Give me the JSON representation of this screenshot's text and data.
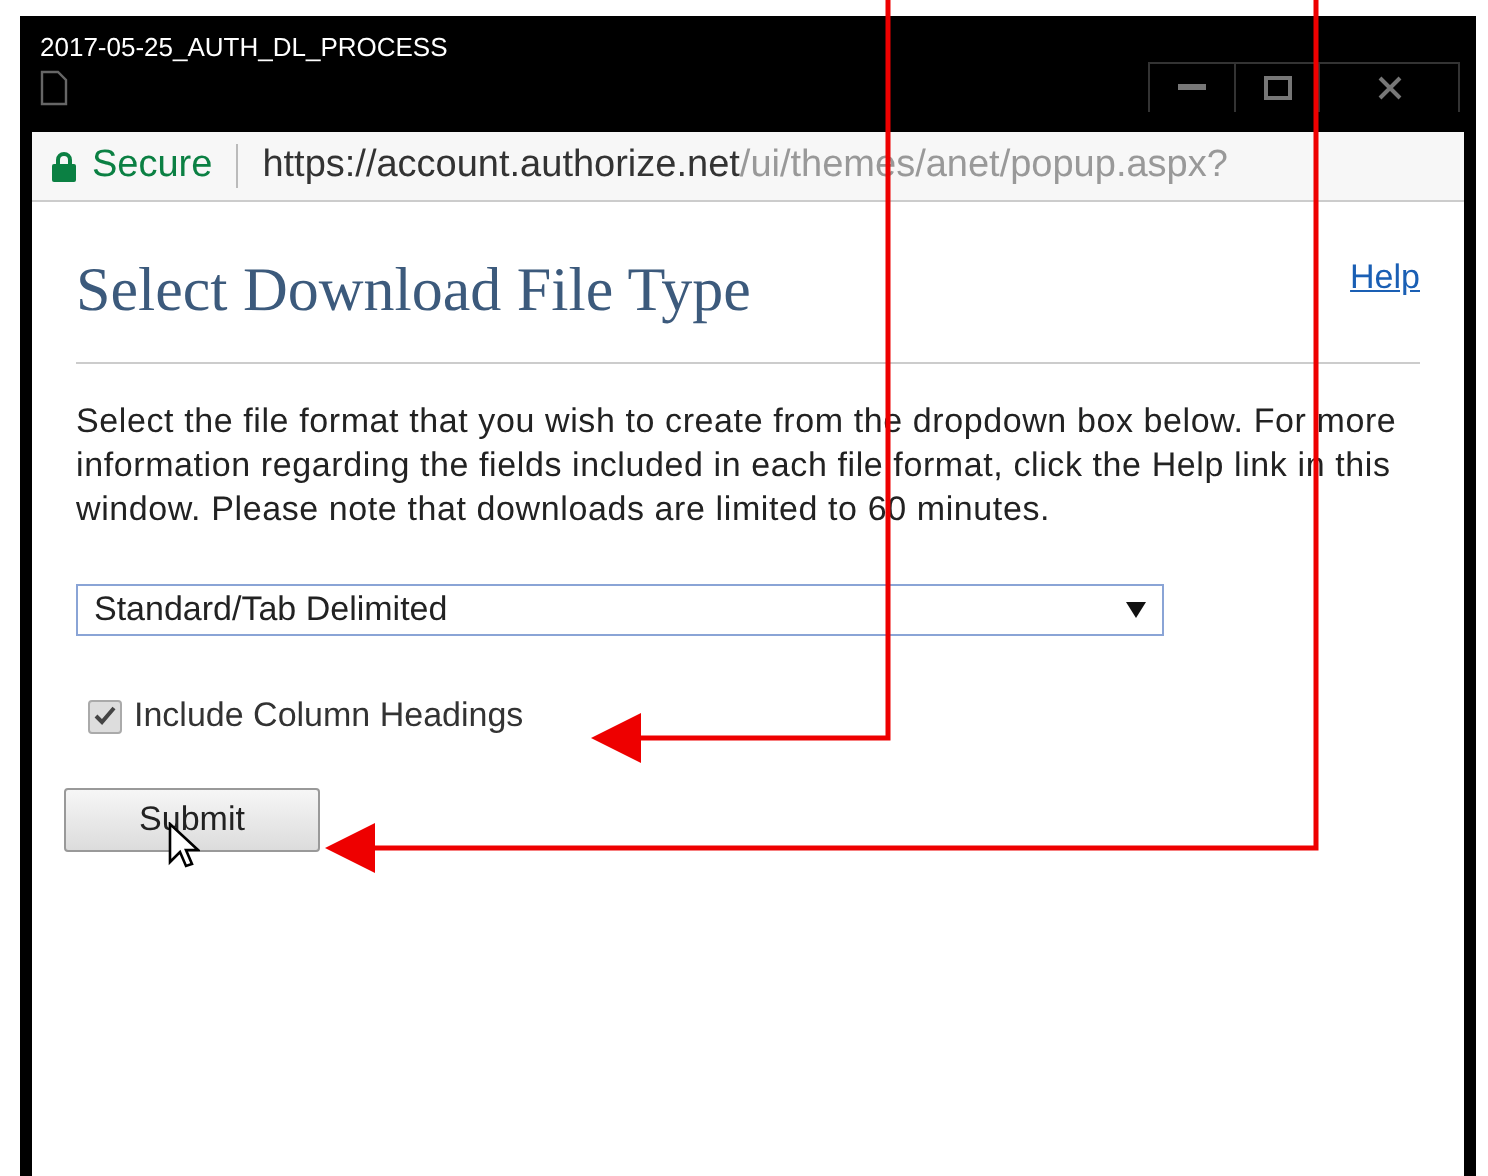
{
  "window": {
    "title": "2017-05-25_AUTH_DL_PROCESS"
  },
  "address_bar": {
    "secure_label": "Secure",
    "url_host": "https://account.authorize.net",
    "url_path": "/ui/themes/anet/popup.aspx?"
  },
  "page": {
    "heading": "Select Download File Type",
    "help_link": "Help",
    "description": "Select the file format that you wish to create from the dropdown box below. For more information regarding the fields included in each file format, click the Help link in this window. Please note that downloads are limited to 60 minutes.",
    "file_type": {
      "value": "Standard/Tab Delimited"
    },
    "include_headings": {
      "label": "Include Column Headings",
      "checked": true
    },
    "submit": {
      "label": "Submit"
    }
  }
}
